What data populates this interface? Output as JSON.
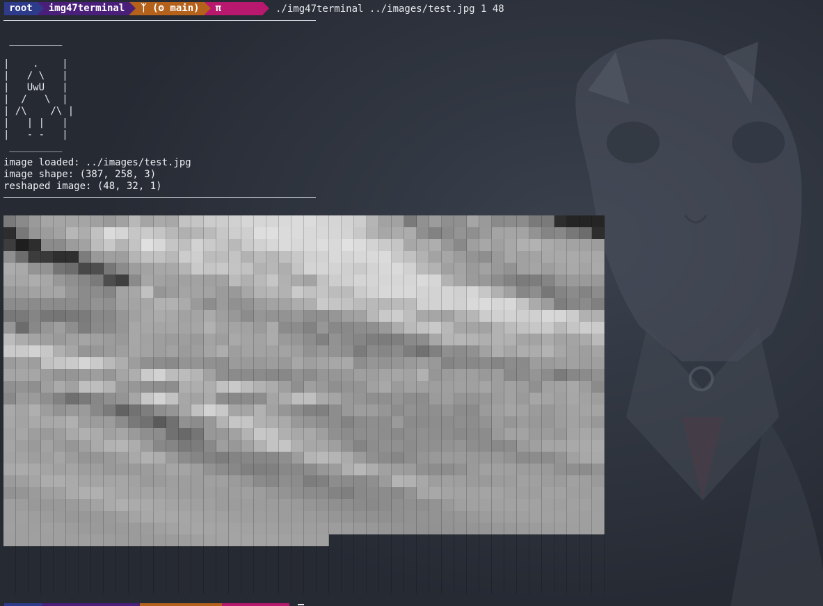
{
  "prompt": {
    "user": "root",
    "directory": "img47terminal",
    "git": "ᛉ (ʘ main)",
    "symbol": "π",
    "command": "./img47terminal ../images/test.jpg 1 48"
  },
  "ascii_logo": [
    " _________",
    "",
    "|    .    |",
    "|   / \\   |",
    "|   UwU   |",
    "|  /   \\  |",
    "| /\\    /\\ |",
    "|   | |   |",
    "|   - -   |",
    " _________"
  ],
  "log": {
    "loaded": "image loaded: ../images/test.jpg",
    "shape": "image shape: (387, 258, 3)",
    "reshaped": "reshaped image: (48, 32, 1)"
  },
  "grayscale_image": {
    "columns": 48,
    "rows": 32,
    "cell_hex": "7a8a9aa5a5a5a5a09aa2b8a5aaa8c3c5cccdd1d6d6d6d9dbdcd6d5d2cdb5a2a27a919c8f90a59a8a8c8c7a7a2d2424252d78959ca2b7adc1dbd5c6cac5b8b0b5bac7cecfdedfdbdbd9d8d6d3c8b3a7abac8f828b948f9ba4a5a4938588786d2d3d1e2d8b8b9ca2bcc8b4c3e0d8c5bfd2cac4b9cad1d7dbd8d9ddd9e1dcd3cac5a7abae98899fa7a0a8b0b2aaa6a3a19d8f6d3c392e2f7c999f9eb5c1c1b8cccebcbcc3b2bbb6bfc8d1d2d9d5d8d9dbc9c1b2a3a69c948e9aa7a1a3a8a9aaa8a8aca99493746d484e778b9da3a7a8b5c9c5c8c4c2b2b7aec4d4d5d3cfcad3d8dad1bab3a0a49aa29993a1a59ea5a9a4aaa6a6ada7988f877a4d3f8aa6a29fa1a2a0a2bbb0b9c6b1aaa3c2cdd0d5d5d6d6d6dad6b2a69b988d837b7d85969a9a99999ca2a4a6958b8c85a3a7c1969ca4a3a39b99a7b3b7b2cac1c4bcbbcbd2d8d8d8d3d3d4d0d6c7b1a1878e77848b838c8c8c8b8c8b8d8b9390a1a4a6b1b1ab9a8d9b91939da3a3adafcac5c2bbb9b7babbd1d2d4d1d9dbd6d8c4ab9d7e868b80787a857775797b888896a1a8aba8a2a4aa9f988c969393998f8f96a0a2b8c9cdbea8a6a2b1b6ccd0d2cfd0d8d6ccb1b0976c88969e8e7d8a8a95a7a6a5a6a4a6b1a3a4a29bab8b8c829788898d8f9aacbac2c9b8a6a4a3b2bcc2c7c9b9c5cdcbbcaca49f9aa0a5a09c99a7a29e9c9e9aa39ea9a4a3ac9a968d81928a857e7c7f8a8da7b5b6b3afb2b1a5a3aba3a4aabacacad2c7b0a695979a9fa6a39ea29b9ea5ad9ea3a2a2a39f9298938f7b8a868b7d71808f8c91a2aea6adacb3a7a29ea49ba19ec1c6cad5cabaae9d908d8a9494918f9b9a999d99a79fa4a7a98e9693969a9e998489888b858c8a9d9b9ea19d9fa5a6a69c94959a9e96a5aecbd2bcbcb5a28f8b8b8b8888928c9696999f9ea4a6a3b1969b9f9f999d898b958c7b878b9190938f9faaa1bfbeb49997918e8daeaeaec1c9bcb2ac9f8f9f998f9394a1a89ba1a09e9fa1a0a59ea29d90a1a2a89e8b899b9b8f826f7a878f94a6c7d3c2a7a3ab8d888b8da5acbebfaaa599958f8f948d8d9b9e9594979ca29aa6a4a0a7a29ea9a4af9d93999b887b62727e8e95a6c1d2c8a5a5b2a2968c82808d999d9d968d928e8f948c8b9ba0a5a29b989ea3a4a4a7a3a9a8a9b09f9c9c8c79715a70918c98b3c5c5b2aeaa99958f8d838b8e8d9a8b8b8d8d8f8d939c969c98979da29f98a3a69e9a9ea9b0aba1a69a8f8d7169759898a2b3c7c4b0a8a99f908c8e8f8d8a8e908e8e8a8b8c9aa2a39b9c98a4a7a4a59f9aa29b96a0aab2b5ad9c8885797c899e98a3b2c3c5b0a7a79f91848d90908c909093958e8c898c9ba0a5a5a9aaaba3a39e9fa59c9595999fa9b1ad9a8c85837d848787888f9db4b9b5ab9b908b868d95999b9b999898938b8c8c94a1a8a9a9aba9a4a1a49e9e999a9a9c9fa5a49e938c88807f8088888c979cafb7ada19e9c918d8d929aa1a0a09d9c9a928f8c939b9fa5acadaaa5a4a5a6a29a9b9f9e9da0a09b968b878e8c7d808d8b8a8f9bb4b1a89ea09f9b9a9c9da1a09d9ca19f9a92959b9fa1aaafb0aaa6a4a3a2a09d9d9e9c9ea09d97948f8c8b837f898b8c8a94a6a8a4a3a2a4a3a09f9ea2a29f9ea09f9d9998999b9ea3aaafabaaa7a4a2a0a09c9c9d9c9c9c9a9693908e8b898c8f908f9399a0a1a1a1a2a3a2a09fa1a19f9fa09e9c9a9898999a9ea4a8a8a8a6a4a2a19f9e9e9d9c9c9b999694929190909293939496999c9e9fa0a1a1a1a09fa0a09f9fa09f9d9b9a999a9b9da0a3a5a6a5a4a3a2a1a09f9f9e9e9d9c9a9896949392929394959698999b9c9d9e9f9fa09f9fa09f9f9f9f9e9d9c9b9b9b9c9ea0a2a3a4a4a3a3a2a1a0a0"
  }
}
